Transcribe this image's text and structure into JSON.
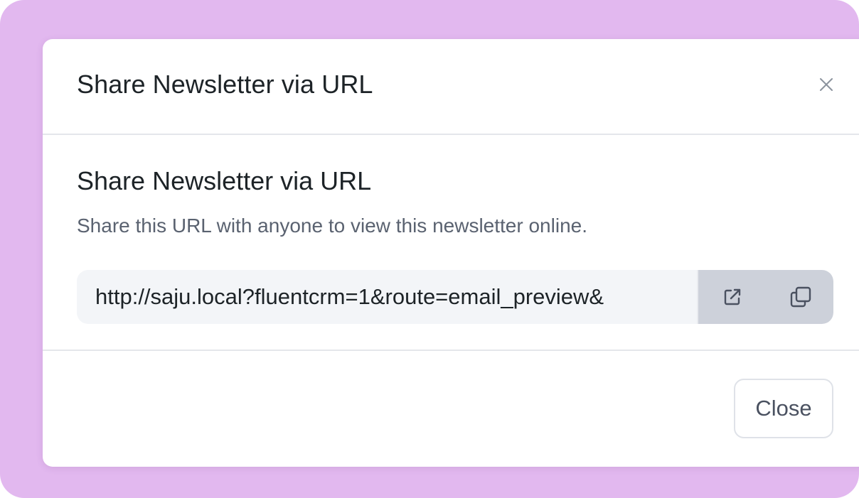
{
  "modal": {
    "title": "Share Newsletter via URL",
    "close_icon": "close-icon"
  },
  "body": {
    "heading": "Share Newsletter via URL",
    "description": "Share this URL with anyone to view this newsletter online.",
    "url_value": "http://saju.local?fluentcrm=1&route=email_preview&",
    "open_icon": "external-link-icon",
    "copy_icon": "copy-icon"
  },
  "footer": {
    "close_label": "Close"
  },
  "colors": {
    "backdrop": "#e2b8ef",
    "action_bg": "#cdd1da",
    "input_bg": "#f3f5f8",
    "text_dark": "#1d2327",
    "text_muted": "#5a6270"
  }
}
